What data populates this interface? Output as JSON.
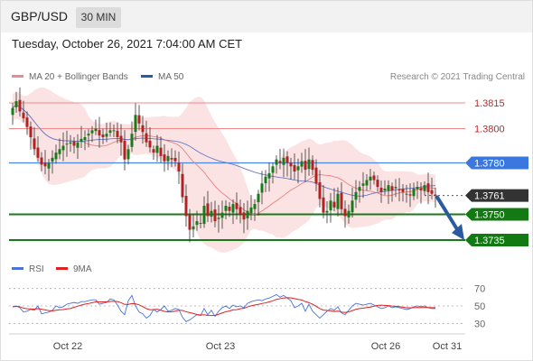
{
  "header": {
    "symbol": "GBP/USD",
    "timeframe": "30 MIN"
  },
  "timestamp": "Tuesday, October 26, 2021 7:04:00 AM CET",
  "legend": {
    "ma20_label": "MA 20 + Bollinger Bands",
    "ma50_label": "MA 50",
    "credit": "Research © 2021 Trading Central",
    "rsi_label": "RSI",
    "rsi_ma_label": "9MA"
  },
  "colors": {
    "bull": "#1a7a1a",
    "bear": "#b22222",
    "band": "#fcdede",
    "ma20": "#e88080",
    "ma50": "#6678c8",
    "support": "#1a7a1a",
    "resistance_red": "#f08a8a",
    "pivot": "#4a86e8",
    "arrow": "#2a5aa0",
    "rsi": "#4a72d8",
    "rsi_ma": "#dd2222"
  },
  "chart_data": [
    {
      "type": "candlestick",
      "title": "GBP/USD 30 MIN",
      "x_labels": [
        "Oct 22",
        "Oct 23",
        "Oct 26",
        "Oct 31"
      ],
      "ylim": [
        1.3725,
        1.3825
      ],
      "levels": [
        {
          "value": 1.3815,
          "label": "1.3815",
          "kind": "resistance"
        },
        {
          "value": 1.38,
          "label": "1.3800",
          "kind": "resistance"
        },
        {
          "value": 1.378,
          "label": "1.3780",
          "kind": "pivot"
        },
        {
          "value": 1.3761,
          "label": "1.3761",
          "kind": "last"
        },
        {
          "value": 1.375,
          "label": "1.3750",
          "kind": "support"
        },
        {
          "value": 1.3735,
          "label": "1.3735",
          "kind": "support"
        }
      ],
      "close": [
        1.3812,
        1.3816,
        1.381,
        1.3806,
        1.3801,
        1.3795,
        1.3788,
        1.3783,
        1.3779,
        1.3778,
        1.378,
        1.3783,
        1.3786,
        1.3788,
        1.379,
        1.3791,
        1.3792,
        1.379,
        1.3792,
        1.3794,
        1.3795,
        1.3797,
        1.3799,
        1.38,
        1.3796,
        1.3795,
        1.3797,
        1.3799,
        1.3799,
        1.3795,
        1.3792,
        1.3782,
        1.3788,
        1.3797,
        1.3808,
        1.3803,
        1.3798,
        1.3792,
        1.3789,
        1.3786,
        1.379,
        1.3784,
        1.3781,
        1.3784,
        1.3782,
        1.3781,
        1.3775,
        1.376,
        1.3749,
        1.3741,
        1.3743,
        1.3746,
        1.3745,
        1.3755,
        1.3749,
        1.3752,
        1.3746,
        1.3748,
        1.3751,
        1.3755,
        1.3752,
        1.3756,
        1.3753,
        1.375,
        1.3747,
        1.3752,
        1.3754,
        1.3756,
        1.3762,
        1.3768,
        1.3772,
        1.3774,
        1.3778,
        1.3782,
        1.378,
        1.3783,
        1.378,
        1.3778,
        1.3775,
        1.3778,
        1.3781,
        1.3776,
        1.3782,
        1.3776,
        1.3768,
        1.3759,
        1.3751,
        1.3752,
        1.3758,
        1.3754,
        1.3762,
        1.3753,
        1.3749,
        1.3752,
        1.3758,
        1.3763,
        1.3766,
        1.3768,
        1.377,
        1.3772,
        1.377,
        1.3766,
        1.3763,
        1.3765,
        1.3767,
        1.3764,
        1.3766,
        1.3764,
        1.3763,
        1.3762,
        1.3761,
        1.3765,
        1.3766,
        1.3764,
        1.3767,
        1.3763,
        1.3762,
        1.3761
      ],
      "rsi": {
        "ylim": [
          20,
          80
        ],
        "ticks": [
          70,
          50,
          30
        ],
        "values": [
          49,
          50,
          48,
          43,
          44,
          46,
          45,
          50,
          41,
          42,
          43,
          45,
          50,
          48,
          49,
          52,
          53,
          54,
          53,
          55,
          55,
          56,
          57,
          57,
          52,
          53,
          54,
          58,
          57,
          51,
          44,
          40,
          56,
          62,
          50,
          43,
          41,
          36,
          39,
          46,
          43,
          46,
          50,
          44,
          45,
          47,
          46,
          37,
          32,
          34,
          37,
          40,
          39,
          47,
          40,
          45,
          38,
          44,
          48,
          50,
          47,
          51,
          49,
          50,
          48,
          53,
          55,
          56,
          57,
          56,
          58,
          59,
          61,
          63,
          60,
          62,
          59,
          56,
          48,
          50,
          53,
          44,
          52,
          44,
          40,
          36,
          40,
          44,
          47,
          45,
          49,
          42,
          40,
          45,
          50,
          53,
          52,
          51,
          52,
          53,
          51,
          49,
          47,
          48,
          50,
          48,
          49,
          48,
          47,
          46,
          47,
          49,
          50,
          49,
          50,
          48,
          47,
          47
        ]
      }
    }
  ]
}
